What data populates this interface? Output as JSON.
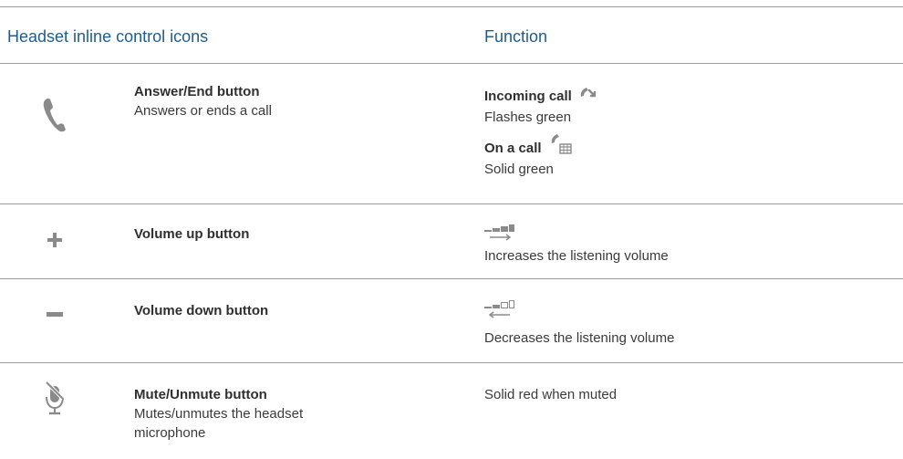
{
  "header": {
    "left": "Headset inline control icons",
    "right": "Function"
  },
  "rows": [
    {
      "icon": "phone-handset-icon",
      "title": "Answer/End button",
      "description": "Answers or ends a call",
      "function": {
        "incoming_title": "Incoming call",
        "incoming_icon": "incoming-call-icon",
        "incoming_desc": "Flashes green",
        "oncall_title": "On a call",
        "oncall_icon": "on-call-icon",
        "oncall_desc": "Solid green"
      }
    },
    {
      "icon": "plus-icon",
      "title": "Volume up button",
      "function": {
        "icon": "volume-increase-icon",
        "desc": "Increases the listening volume"
      }
    },
    {
      "icon": "minus-icon",
      "title": "Volume down button",
      "function": {
        "icon": "volume-decrease-icon",
        "desc": "Decreases the listening volume"
      }
    },
    {
      "icon": "microphone-muted-icon",
      "title": "Mute/Unmute button",
      "description_line1": "Mutes/unmutes the headset",
      "description_line2": "microphone",
      "function": {
        "desc": "Solid red when muted"
      }
    }
  ],
  "colors": {
    "header": "#1f5d8c",
    "text": "#3a3a3a",
    "icon": "#8a8a8a",
    "rule": "#9a9a9a"
  }
}
